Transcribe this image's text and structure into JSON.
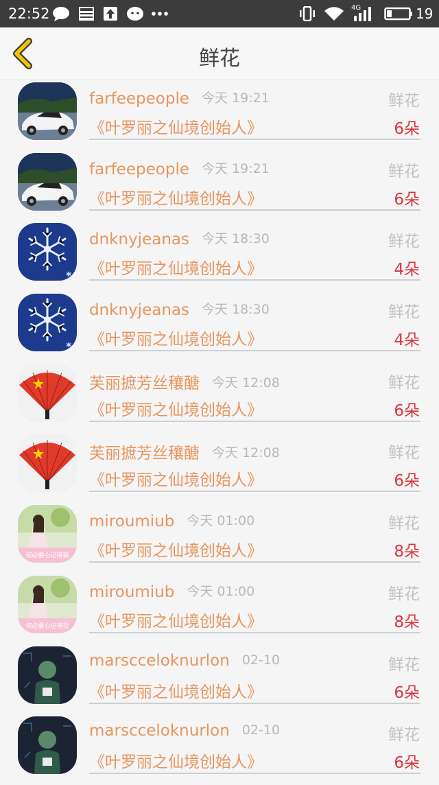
{
  "status_bar": {
    "time": "22:52",
    "battery": "19",
    "left_icons": [
      "chat-bubble-icon",
      "news-icon",
      "upload-icon",
      "wechat-icon",
      "more-dots-icon"
    ],
    "right_icons": [
      "vibrate-icon",
      "wifi-icon",
      "signal-4g-icon",
      "battery-icon"
    ],
    "network": "4G"
  },
  "nav": {
    "title": "鲜花"
  },
  "colors": {
    "name": "#e8955e",
    "count": "#d9363e",
    "muted": "#b8b8b8",
    "back_arrow": "#f2c500"
  },
  "items": [
    {
      "user": "farfeepeople",
      "time": "今天 19:21",
      "type": "鲜花",
      "book": "《叶罗丽之仙境创始人》",
      "count": "6朵",
      "avatar": "car"
    },
    {
      "user": "farfeepeople",
      "time": "今天 19:21",
      "type": "鲜花",
      "book": "《叶罗丽之仙境创始人》",
      "count": "6朵",
      "avatar": "car"
    },
    {
      "user": "dnknyjeanas",
      "time": "今天 18:30",
      "type": "鲜花",
      "book": "《叶罗丽之仙境创始人》",
      "count": "4朵",
      "avatar": "snowflake"
    },
    {
      "user": "dnknyjeanas",
      "time": "今天 18:30",
      "type": "鲜花",
      "book": "《叶罗丽之仙境创始人》",
      "count": "4朵",
      "avatar": "snowflake"
    },
    {
      "user": "芙丽摭芳丝穰醣",
      "time": "今天 12:08",
      "type": "鲜花",
      "book": "《叶罗丽之仙境创始人》",
      "count": "6朵",
      "avatar": "fan"
    },
    {
      "user": "芙丽摭芳丝穰醣",
      "time": "今天 12:08",
      "type": "鲜花",
      "book": "《叶罗丽之仙境创始人》",
      "count": "6朵",
      "avatar": "fan"
    },
    {
      "user": "miroumiub",
      "time": "今天 01:00",
      "type": "鲜花",
      "book": "《叶罗丽之仙境创始人》",
      "count": "8朵",
      "avatar": "girl",
      "avatar_text": "何必要心记得我"
    },
    {
      "user": "miroumiub",
      "time": "今天 01:00",
      "type": "鲜花",
      "book": "《叶罗丽之仙境创始人》",
      "count": "8朵",
      "avatar": "girl",
      "avatar_text": "何必要心记得我"
    },
    {
      "user": "marscceloknurlon",
      "time": "02-10",
      "type": "鲜花",
      "book": "《叶罗丽之仙境创始人》",
      "count": "6朵",
      "avatar": "dark"
    },
    {
      "user": "marscceloknurlon",
      "time": "02-10",
      "type": "鲜花",
      "book": "《叶罗丽之仙境创始人》",
      "count": "6朵",
      "avatar": "dark"
    }
  ]
}
